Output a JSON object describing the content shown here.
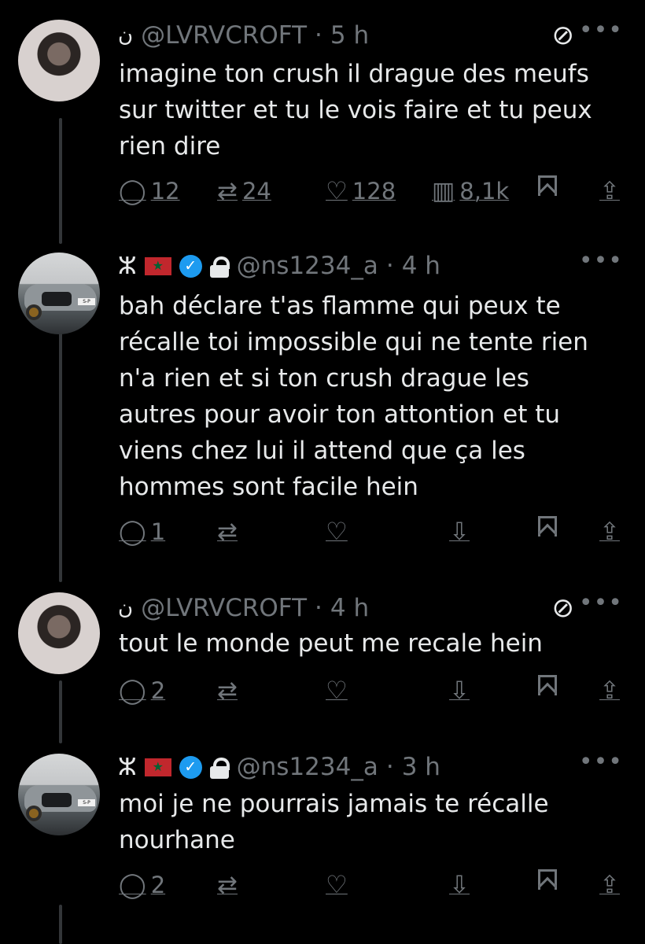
{
  "tweets": [
    {
      "name_glyph": "ن",
      "handle": "@LVRVCROFT",
      "time": "5 h",
      "text": "imagine ton crush il drague des meufs\nsur twitter et tu le vois faire et tu peux\nrien dire",
      "counts": {
        "reply": "12",
        "retweet": "24",
        "like": "128",
        "views": "8,1k"
      }
    },
    {
      "name_glyph": "ⵣ",
      "handle": "@ns1234_a",
      "time": "4 h",
      "text": "bah déclare t'as flamme qui peux te\nrécalle toi impossible qui ne tente rien\nn'a rien et si ton crush drague les\nautres pour avoir ton attontion et tu\nviens chez lui il attend que ça les\nhommes sont facile hein",
      "counts": {
        "reply": "1"
      }
    },
    {
      "name_glyph": "ن",
      "handle": "@LVRVCROFT",
      "time": "4 h",
      "text": "tout le monde peut me recale hein",
      "counts": {
        "reply": "2"
      }
    },
    {
      "name_glyph": "ⵣ",
      "handle": "@ns1234_a",
      "time": "3 h",
      "text": "moi je ne pourrais jamais te récalle\nnourhane",
      "counts": {
        "reply": "2"
      }
    }
  ],
  "separator": "·",
  "icons": {
    "reply": "reply-icon",
    "retweet": "retweet-icon",
    "like": "heart-icon",
    "views": "views-icon",
    "bookmark": "bookmark-icon",
    "share": "share-icon",
    "more": "more-icon",
    "dislike": "downvote-icon",
    "verified": "verified-icon",
    "lock": "lock-icon",
    "flag": "morocco-flag-icon",
    "muted": "slash-icon"
  },
  "colors": {
    "background": "#000000",
    "text": "#e7e9ea",
    "secondary": "#71767b",
    "verified": "#1d9bf0",
    "thread_line": "#333639"
  }
}
